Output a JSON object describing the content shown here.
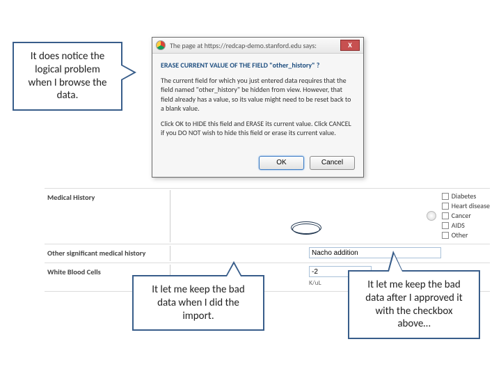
{
  "callouts": {
    "top_left": "It does notice the logical problem when I browse the data.",
    "bottom_left": "It let me keep the bad data when I did the import.",
    "bottom_right": "It let me keep the bad data after I approved it with the checkbox above…"
  },
  "dialog": {
    "source": "The page at https://redcap-demo.stanford.edu says:",
    "close": "X",
    "heading": "ERASE CURRENT VALUE OF THE FIELD \"other_history\" ?",
    "p1": "The current field for which you just entered data requires that the field named \"other_history\" be hidden from view. However, that field already has a value, so its value might need to be reset back to a blank value.",
    "p2": "Click OK to HIDE this field and ERASE its current value. Click CANCEL if you DO NOT wish to hide this field or erase its current value.",
    "ok": "OK",
    "cancel": "Cancel"
  },
  "form": {
    "medhist_label": "Medical History",
    "options": [
      "Diabetes",
      "Heart disease",
      "Cancer",
      "AIDS",
      "Other"
    ],
    "other_label": "Other significant medical history",
    "other_value": "Nacho addition",
    "wbc_label": "White Blood Cells",
    "wbc_value": "-2",
    "wbc_unit": "K/uL"
  }
}
